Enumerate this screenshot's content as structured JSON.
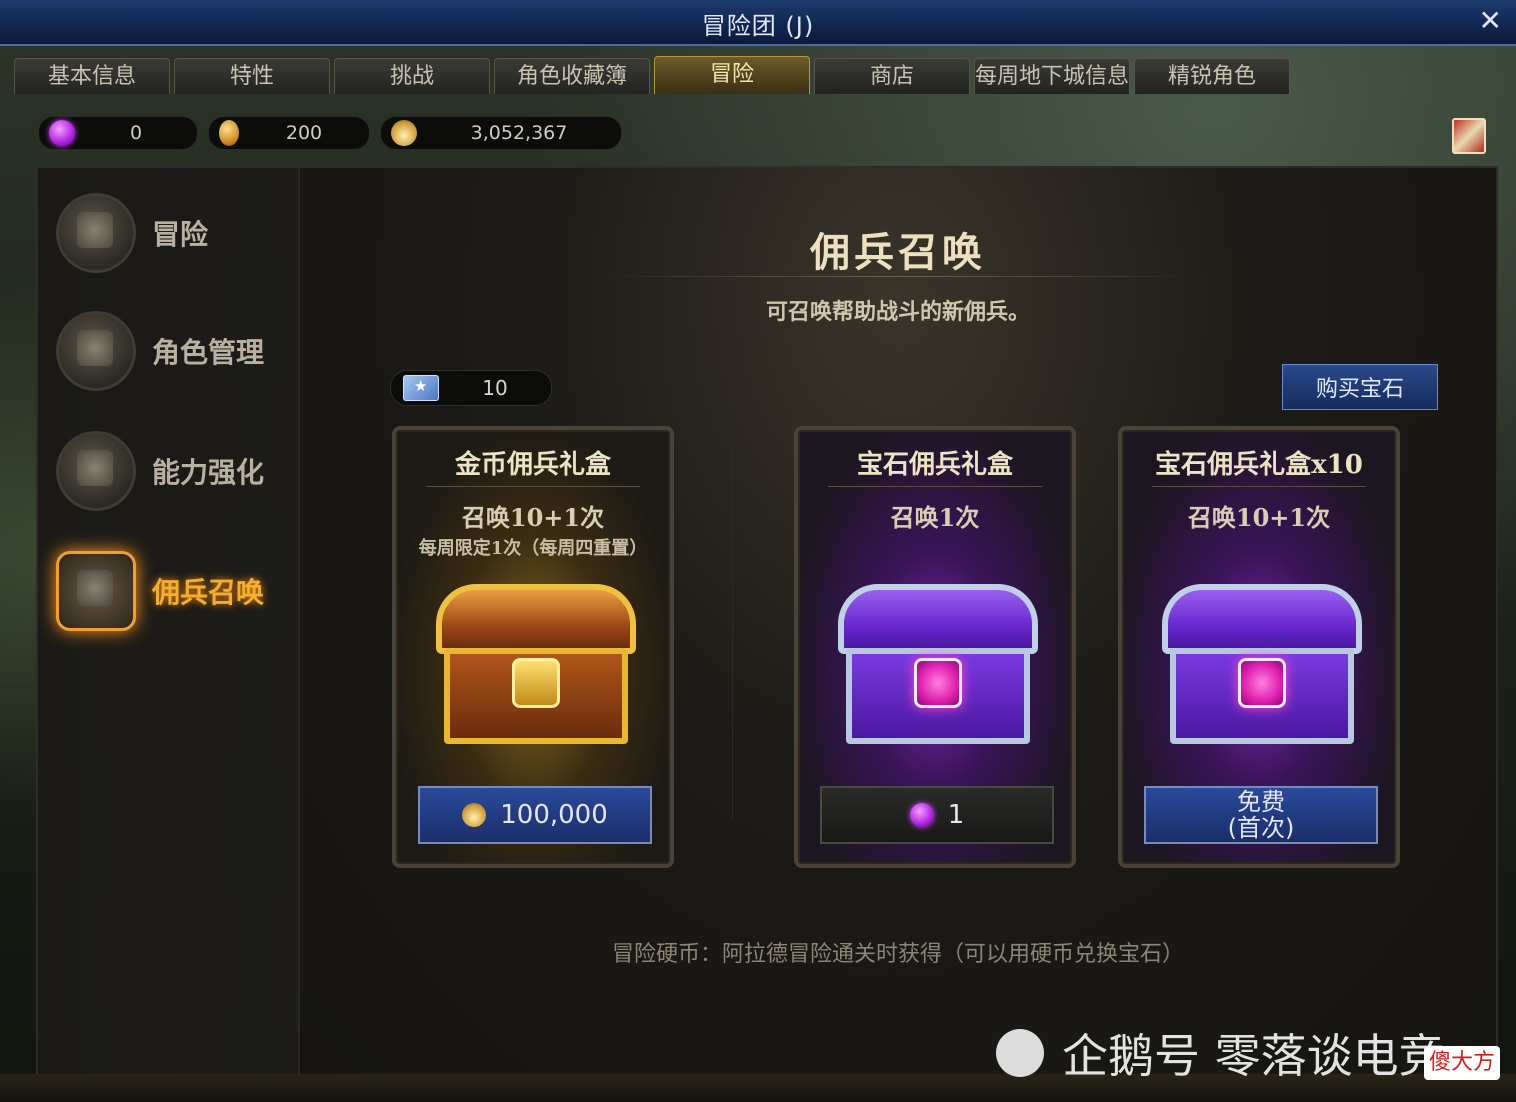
{
  "window": {
    "title": "冒险团 (J)",
    "close": "✕"
  },
  "tabs": [
    "基本信息",
    "特性",
    "挑战",
    "角色收藏簿",
    "冒险",
    "商店",
    "每周地下城信息",
    "精锐角色"
  ],
  "active_tab": 4,
  "currency": {
    "gems": "0",
    "coins": "200",
    "gold": "3,052,367"
  },
  "sidebar": {
    "items": [
      {
        "label": "冒险",
        "icon": "flag-icon"
      },
      {
        "label": "角色管理",
        "icon": "character-icon"
      },
      {
        "label": "能力强化",
        "icon": "shuriken-icon"
      },
      {
        "label": "佣兵召唤",
        "icon": "shield-icon"
      }
    ],
    "active": 3
  },
  "content": {
    "title": "佣兵召唤",
    "subtitle": "可召唤帮助战斗的新佣兵。",
    "ticket_count": "10",
    "buy_gem_button": "购买宝石",
    "footer_note": "冒险硬币：阿拉德冒险通关时获得（可以用硬币兑换宝石）"
  },
  "cards": [
    {
      "title": "金币佣兵礼盒",
      "summon": "召唤10+1次",
      "note": "每周限定1次（每周四重置）",
      "button": "100,000",
      "button_icon": "gold-icon",
      "theme": "gold"
    },
    {
      "title": "宝石佣兵礼盒",
      "summon": "召唤1次",
      "note": "",
      "button": "1",
      "button_icon": "gem-icon",
      "theme": "gem"
    },
    {
      "title": "宝石佣兵礼盒x10",
      "summon": "召唤10+1次",
      "note": "",
      "button_line1": "免费",
      "button_line2": "(首次)",
      "theme": "gem"
    }
  ],
  "watermark": {
    "text": "企鹅号 零落谈电竞",
    "badge": "傻大方"
  },
  "colors": {
    "accent": "#f0a030",
    "button_blue": "#2a4a9a",
    "gem_purple": "#b020e0"
  }
}
